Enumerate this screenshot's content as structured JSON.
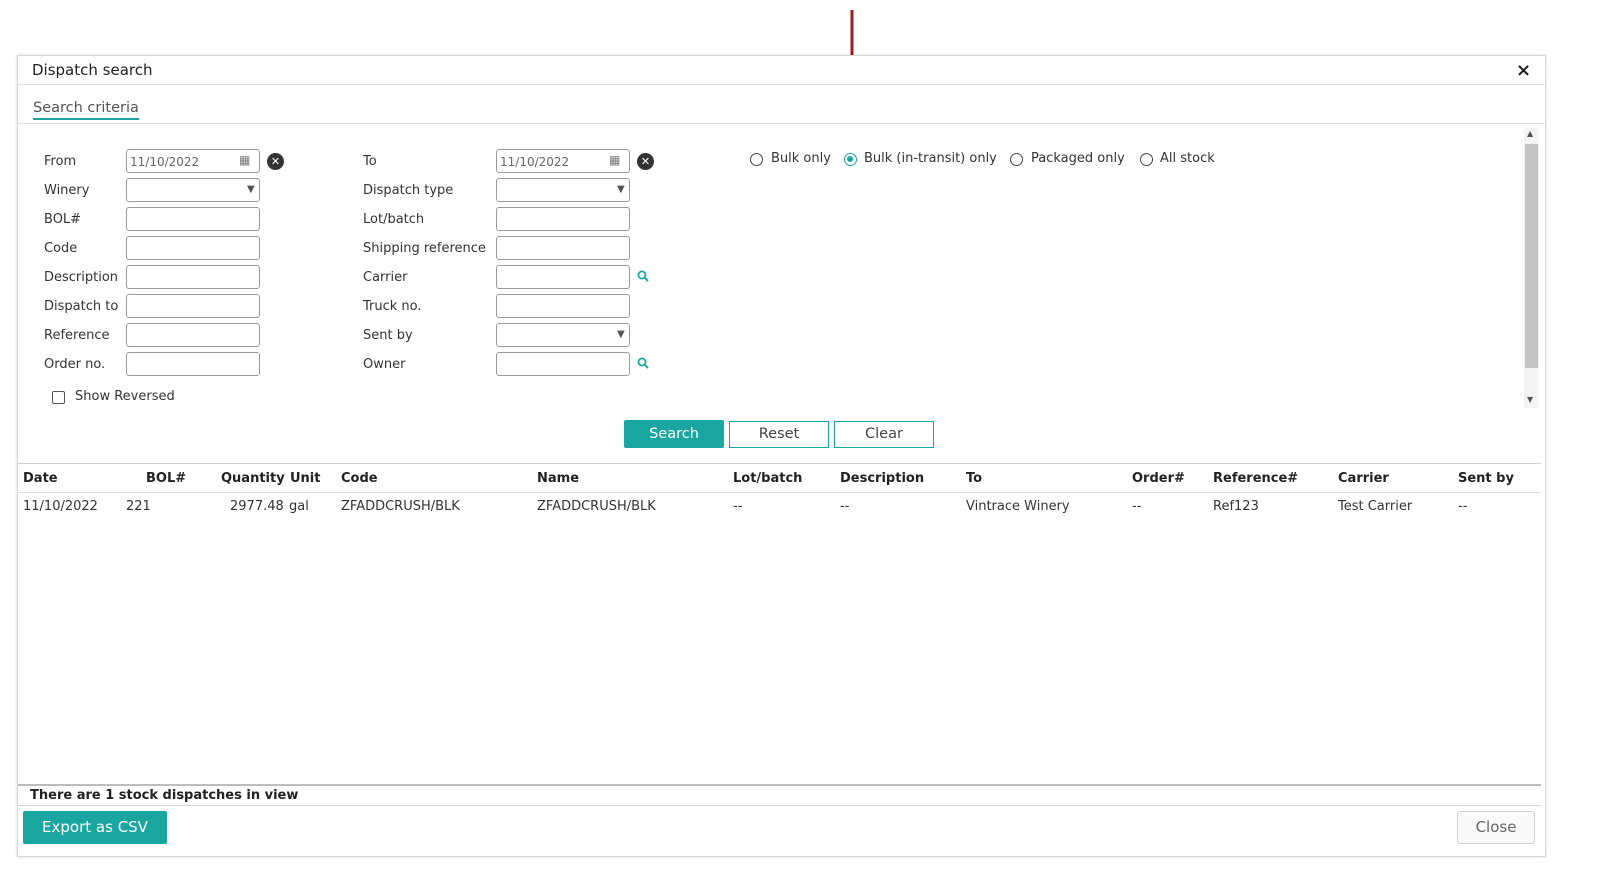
{
  "dialog": {
    "title": "Dispatch search",
    "close_icon": "×"
  },
  "tabs": {
    "search_criteria": "Search criteria"
  },
  "left_fields": {
    "from_label": "From",
    "from_value": "11/10/2022",
    "winery_label": "Winery",
    "bol_label": "BOL#",
    "code_label": "Code",
    "description_label": "Description",
    "dispatch_to_label": "Dispatch to",
    "reference_label": "Reference",
    "order_no_label": "Order no."
  },
  "right_fields": {
    "to_label": "To",
    "to_value": "11/10/2022",
    "dispatch_type_label": "Dispatch type",
    "lot_batch_label": "Lot/batch",
    "shipping_reference_label": "Shipping reference",
    "carrier_label": "Carrier",
    "truck_no_label": "Truck no.",
    "sent_by_label": "Sent by",
    "owner_label": "Owner"
  },
  "stock_filter": {
    "options": [
      "Bulk only",
      "Bulk (in-transit) only",
      "Packaged only",
      "All stock"
    ],
    "selected": "Bulk (in-transit) only"
  },
  "show_reversed": {
    "label": "Show Reversed",
    "checked": false
  },
  "buttons": {
    "search": "Search",
    "reset": "Reset",
    "clear": "Clear",
    "export_csv": "Export as CSV",
    "close": "Close"
  },
  "table": {
    "headers": [
      "Date",
      "BOL#",
      "Quantity",
      "Unit",
      "Code",
      "Name",
      "Lot/batch",
      "Description",
      "To",
      "Order#",
      "Reference#",
      "Carrier",
      "Sent by"
    ],
    "rows": [
      [
        "11/10/2022",
        "221",
        "2977.48",
        "gal",
        "ZFADDCRUSH/BLK",
        "ZFADDCRUSH/BLK",
        "--",
        "--",
        "Vintrace Winery",
        "--",
        "Ref123",
        "Test Carrier",
        "--"
      ]
    ]
  },
  "status": {
    "text": "There are 1 stock dispatches in view"
  },
  "colors": {
    "accent": "#19a6a0",
    "arrow": "#9b1c1c"
  }
}
